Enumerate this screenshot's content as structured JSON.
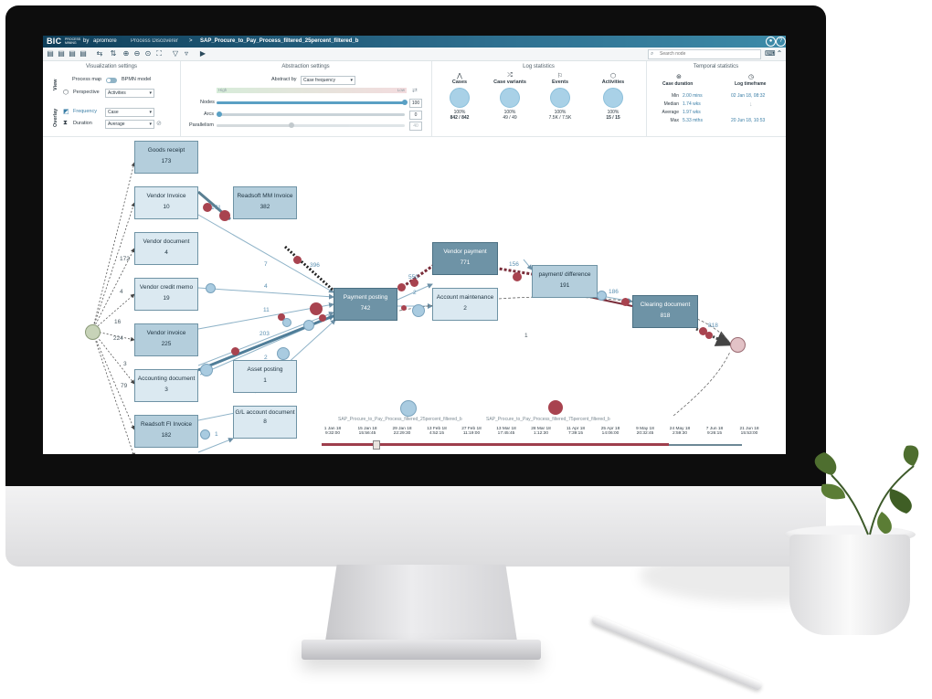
{
  "app": {
    "logo": "BIC",
    "logo_sub": "PROCESS MINING",
    "by": "by",
    "vendor": "apromore",
    "section": "Process Discoverer",
    "separator": ">",
    "file": "SAP_Procure_to_Pay_Process_filtered_25percent_filtered_b"
  },
  "toolbar": {
    "search_placeholder": "Search node",
    "icons": [
      "file-icon",
      "file-icon",
      "file-icon",
      "file-icon",
      "layout-icon",
      "sort-icon",
      "zoom-in-icon",
      "zoom-out-icon",
      "fit-icon",
      "filter-icon",
      "filter-clear-icon",
      "play-icon"
    ]
  },
  "viz": {
    "title": "Visualization settings",
    "view_label": "View",
    "overlay_label": "Overlay",
    "process_map": "Process map",
    "bpmn": "BPMN model",
    "perspective_label": "Perspective",
    "perspective_value": "Activities",
    "frequency_label": "Frequency",
    "frequency_value": "Case",
    "duration_label": "Duration",
    "duration_value": "Average"
  },
  "abstraction": {
    "title": "Abstraction settings",
    "abstract_by_label": "Abstract by",
    "abstract_by_value": "Case frequency",
    "high": "High",
    "low": "Low",
    "nodes_label": "Nodes",
    "nodes_value": "100",
    "nodes_level": 1.0,
    "arcs_label": "Arcs",
    "arcs_value": "0",
    "arcs_level": 0.0,
    "parallelism_label": "Parallelism",
    "parallelism_value": "40",
    "parallelism_level": 0.4
  },
  "log_stats": {
    "title": "Log statistics",
    "items": [
      {
        "label": "Cases",
        "pct": "100%",
        "value": "842 / 842"
      },
      {
        "label": "Case variants",
        "pct": "100%",
        "value": "49 / 49"
      },
      {
        "label": "Events",
        "pct": "100%",
        "value": "7.5K / 7.5K"
      },
      {
        "label": "Activities",
        "pct": "100%",
        "value": "15 / 15"
      }
    ]
  },
  "temporal": {
    "title": "Temporal statistics",
    "case_duration": "Case duration",
    "log_timeframe": "Log timeframe",
    "rows": [
      {
        "k": "Min",
        "v": "2.00 mins"
      },
      {
        "k": "Median",
        "v": "1.74 wks"
      },
      {
        "k": "Average",
        "v": "1.97 wks"
      },
      {
        "k": "Max",
        "v": "5.33 mths"
      }
    ],
    "start": "02 Jan 18, 08:32",
    "end": "20 Jun 18, 10:53"
  },
  "nodes": {
    "goods_receipt": {
      "name": "Goods receipt",
      "count": "173"
    },
    "vendor_invoice_a": {
      "name": "Vendor Invoice",
      "count": "10"
    },
    "vendor_document": {
      "name": "Vendor document",
      "count": "4"
    },
    "vendor_credit_memo": {
      "name": "Vendor credit memo",
      "count": "19"
    },
    "vendor_invoice_b": {
      "name": "Vendor invoice",
      "count": "225"
    },
    "accounting_document": {
      "name": "Accounting document",
      "count": "3"
    },
    "readsoft_fi": {
      "name": "Readsoft FI Invoice",
      "count": "182"
    },
    "readsoft_mm": {
      "name": "Readsoft MM Invoice",
      "count": "382"
    },
    "asset_posting": {
      "name": "Asset posting",
      "count": "1"
    },
    "gl_account": {
      "name": "G/L account document",
      "count": "8"
    },
    "payment_posting": {
      "name": "Payment posting",
      "count": "742"
    },
    "account_maintenance": {
      "name": "Account maintenance",
      "count": "2"
    },
    "vendor_payment": {
      "name": "Vendor payment",
      "count": "771"
    },
    "payment_difference": {
      "name": "payment/  difference",
      "count": "191"
    },
    "clearing_document": {
      "name": "Clearing document",
      "count": "818"
    }
  },
  "edges": {
    "e171": "171",
    "e172": "172",
    "e7": "7",
    "e4a": "4",
    "e4b": "4",
    "e16": "16",
    "e11": "11",
    "e224": "224",
    "e203": "203",
    "e3": "3",
    "e79": "79",
    "e2a": "2",
    "e1a": "1",
    "e5": "5",
    "e1b": "1",
    "e396": "396",
    "e550": "550",
    "e2b": "2",
    "e156": "156",
    "e186": "186",
    "e818": "818",
    "e1c": "1"
  },
  "timeline": {
    "left_title": "SAP_Procure_to_Pay_Process_filtered_25percent_filtered_b",
    "right_title": "SAP_Procure_to_Pay_Process_filtered_75percent_filtered_b",
    "ticks": [
      {
        "d": "1 Jan 18",
        "t": "9:32:00"
      },
      {
        "d": "15 Jan 18",
        "t": "15:56:45"
      },
      {
        "d": "29 Jan 18",
        "t": "22:29:30"
      },
      {
        "d": "13 Feb 18",
        "t": "4:52:15"
      },
      {
        "d": "27 Feb 18",
        "t": "11:19:00"
      },
      {
        "d": "13 Mar 18",
        "t": "17:45:45"
      },
      {
        "d": "28 Mar 18",
        "t": "1:12:30"
      },
      {
        "d": "11 Apr 18",
        "t": "7:39:15"
      },
      {
        "d": "25 Apr 18",
        "t": "14:06:00"
      },
      {
        "d": "9 May 18",
        "t": "20:32:45"
      },
      {
        "d": "24 May 18",
        "t": "2:59:30"
      },
      {
        "d": "7 Jun 18",
        "t": "9:26:15"
      },
      {
        "d": "21 Jun 18",
        "t": "15:53:00"
      }
    ]
  },
  "colors": {
    "accent": "#2e6f8f",
    "node_light": "#dbe9f1",
    "node_dark": "#6e93a6",
    "token_blue": "#a9cbe0",
    "token_red": "#a8434f"
  }
}
